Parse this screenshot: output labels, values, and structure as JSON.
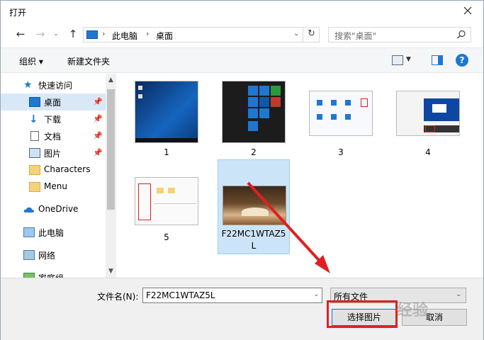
{
  "window": {
    "title": "打开"
  },
  "address": {
    "crumbs": [
      "此电脑",
      "桌面"
    ]
  },
  "search": {
    "placeholder": "搜索\"桌面\""
  },
  "toolbar": {
    "organize": "组织 ▾",
    "new_folder": "新建文件夹",
    "help": "?"
  },
  "navpane": {
    "items": [
      {
        "label": "快速访问",
        "icon": "star-icon"
      },
      {
        "label": "桌面",
        "icon": "desktop-icon",
        "selected": true,
        "pinned": true
      },
      {
        "label": "下载",
        "icon": "download-icon",
        "pinned": true
      },
      {
        "label": "文档",
        "icon": "document-icon",
        "pinned": true
      },
      {
        "label": "图片",
        "icon": "picture-icon",
        "pinned": true
      },
      {
        "label": "Characters",
        "icon": "folder-icon"
      },
      {
        "label": "Menu",
        "icon": "folder-icon"
      },
      {
        "label": "OneDrive",
        "icon": "cloud-icon"
      },
      {
        "label": "此电脑",
        "icon": "computer-icon"
      },
      {
        "label": "网络",
        "icon": "network-icon"
      },
      {
        "label": "家庭组",
        "icon": "homegroup-icon"
      }
    ]
  },
  "files": [
    {
      "name": "1"
    },
    {
      "name": "2"
    },
    {
      "name": "3"
    },
    {
      "name": "4"
    },
    {
      "name": "5"
    },
    {
      "name": "F22MC1WTAZ5L",
      "selected": true
    }
  ],
  "bottom": {
    "filename_label": "文件名(N):",
    "filename_value": "F22MC1WTAZ5L",
    "filter_value": "所有文件",
    "open_button": "选择图片",
    "cancel_button": "取消"
  },
  "watermark": "经验",
  "colors": {
    "accent": "#1e78d2",
    "selection": "#cce4f7",
    "highlight": "#e02020"
  }
}
